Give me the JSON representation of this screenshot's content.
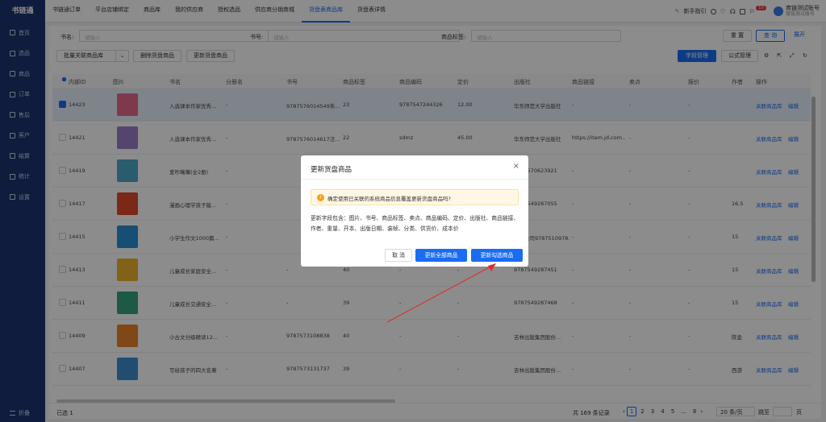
{
  "app": {
    "logo": "书链通"
  },
  "sidebar": {
    "items": [
      {
        "label": "首页",
        "icon": "home-icon"
      },
      {
        "label": "选品",
        "icon": "select-icon"
      },
      {
        "label": "商品",
        "icon": "goods-icon"
      },
      {
        "label": "订单",
        "icon": "order-icon"
      },
      {
        "label": "售后",
        "icon": "aftersale-icon"
      },
      {
        "label": "客户",
        "icon": "customer-icon"
      },
      {
        "label": "结算",
        "icon": "settle-icon"
      },
      {
        "label": "统计",
        "icon": "stats-icon"
      },
      {
        "label": "设置",
        "icon": "settings-icon"
      }
    ],
    "collapse_label": "折叠"
  },
  "topnav": {
    "tabs": [
      "书链通订单",
      "平台店铺绑定",
      "商品库",
      "我的供应商",
      "授权选品",
      "供应商分销商城",
      "货盘表商品库",
      "货盘表详情"
    ],
    "active_index": 6,
    "guide": "新手指引",
    "badge": "10",
    "user_name": "育链测试账号",
    "user_account": "育链测试账号"
  },
  "filters": {
    "book_name_label": "书名:",
    "book_name_placeholder": "请输入",
    "book_no_label": "书号:",
    "book_no_placeholder": "请输入",
    "tag_label": "商品标签:",
    "tag_placeholder": "请输入",
    "reset": "重 置",
    "query": "查 询",
    "expand": "展开"
  },
  "toolbar": {
    "batch_link": "批量关联商品库",
    "delete": "删除货盘商品",
    "update": "更新货盘商品",
    "field_manage": "字段管理",
    "formula_manage": "公式管理"
  },
  "table": {
    "columns": [
      "内部ID",
      "图片",
      "书名",
      "分册名",
      "书号",
      "商品标签",
      "商品编码",
      "定价",
      "出版社",
      "商品链接",
      "卖点",
      "报价",
      "作者",
      "操作"
    ],
    "rows": [
      {
        "id": "14423",
        "name": "入选课本作家优秀...",
        "sub": "-",
        "isbn": "9787576014549朱...",
        "tag": "23",
        "code": "9787547244326",
        "price": "12.00",
        "publisher": "华东师范大学出版社",
        "link": "-",
        "point": "-",
        "quote": "-",
        "author": "",
        "selected": true,
        "color": "#e56a8a"
      },
      {
        "id": "14421",
        "name": "入选课本作家优秀...",
        "sub": "-",
        "isbn": "9787576014617汪...",
        "tag": "22",
        "code": "sdmz",
        "price": "45.00",
        "publisher": "华东师范大学出版社",
        "link": "https://item.jd.com....",
        "point": "-",
        "quote": "-",
        "author": "",
        "selected": false,
        "color": "#9a7ec9"
      },
      {
        "id": "14419",
        "name": "爱吵嘴嘴(全2册)",
        "sub": "-",
        "isbn": "",
        "tag": "",
        "code": "",
        "price": "",
        "publisher": "9787570623921",
        "link": "-",
        "point": "-",
        "quote": "-",
        "author": "",
        "selected": false,
        "color": "#4da8c9"
      },
      {
        "id": "14417",
        "name": "漫画心理学孩子能...",
        "sub": "-",
        "isbn": "",
        "tag": "",
        "code": "",
        "price": "",
        "publisher": "9787549287055",
        "link": "-",
        "point": "-",
        "quote": "-",
        "author": "16.5",
        "selected": false,
        "color": "#e0492d"
      },
      {
        "id": "14415",
        "name": "小学生作文1000篇...",
        "sub": "-",
        "isbn": "",
        "tag": "",
        "code": "",
        "price": "",
        "publisher": "有限公司9787510978...",
        "link": "-",
        "point": "-",
        "quote": "-",
        "author": "15",
        "selected": false,
        "color": "#2a8fd6"
      },
      {
        "id": "14413",
        "name": "儿童成长家庭安全...",
        "sub": "-",
        "isbn": "-",
        "tag": "40",
        "code": "-",
        "price": "-",
        "publisher": "9787549287451",
        "link": "-",
        "point": "-",
        "quote": "-",
        "author": "15",
        "selected": false,
        "color": "#f0b12c"
      },
      {
        "id": "14411",
        "name": "儿童成长交通安全...",
        "sub": "-",
        "isbn": "-",
        "tag": "39",
        "code": "-",
        "price": "-",
        "publisher": "9787549287468",
        "link": "-",
        "point": "-",
        "quote": "-",
        "author": "15",
        "selected": false,
        "color": "#35a37a"
      },
      {
        "id": "14409",
        "name": "小古文分级精读12...",
        "sub": "-",
        "isbn": "9787573108838",
        "tag": "40",
        "code": "-",
        "price": "-",
        "publisher": "吉林出版集团股份...",
        "link": "-",
        "point": "-",
        "quote": "-",
        "author": "陈金",
        "selected": false,
        "color": "#e9832b"
      },
      {
        "id": "14407",
        "name": "写给孩子的四大名著",
        "sub": "-",
        "isbn": "9787573131737",
        "tag": "39",
        "code": "-",
        "price": "-",
        "publisher": "吉林出版集团股份...",
        "link": "-",
        "point": "-",
        "quote": "-",
        "author": "西游",
        "selected": false,
        "color": "#3b8fd1"
      }
    ],
    "action_link": "关联商品库",
    "action_edit": "编辑"
  },
  "footer": {
    "selected_text": "已选 1",
    "total": "共 169 条记录",
    "pages": [
      "1",
      "2",
      "3",
      "4",
      "5",
      "...",
      "8"
    ],
    "active_page": "1",
    "page_size": "20 条/页",
    "goto_label": "跳至",
    "page_unit": "页"
  },
  "modal": {
    "title": "更新货盘商品",
    "alert": "确定使用已关联的系统商品信息覆盖更新货盘商品吗?",
    "desc": "更新字段包含：图片、书号、商品标签、卖点、商品编码、定价、出版社、商品链接、作者、重量、开本、出版日期、装帧、分类、供货价、成本价",
    "cancel": "取 消",
    "update_all": "更新全部商品",
    "update_selected": "更新勾选商品"
  },
  "colors": {
    "primary": "#1a6cf2",
    "sidebar": "#1d3370",
    "arrow": "#e02b2b"
  }
}
